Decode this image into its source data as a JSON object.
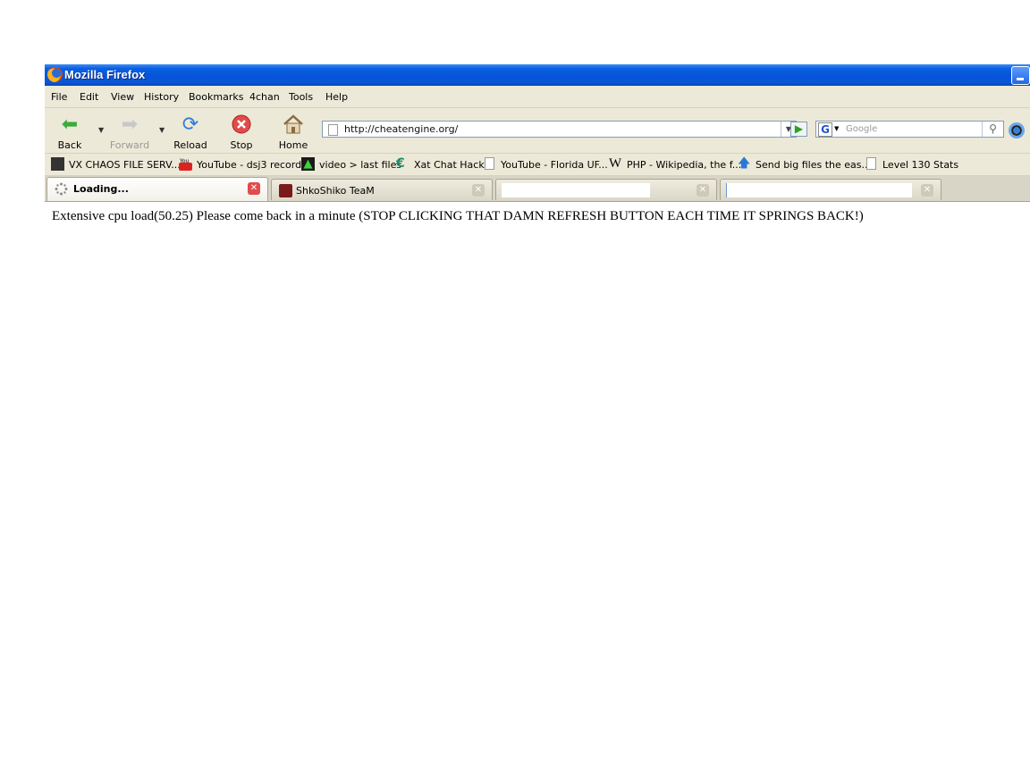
{
  "window": {
    "title": "Mozilla Firefox"
  },
  "menu": [
    "File",
    "Edit",
    "View",
    "History",
    "Bookmarks",
    "4chan",
    "Tools",
    "Help"
  ],
  "nav": {
    "back_label": "Back",
    "forward_label": "Forward",
    "reload_label": "Reload",
    "stop_label": "Stop",
    "home_label": "Home"
  },
  "address": {
    "url": "http://cheatengine.org/"
  },
  "search": {
    "placeholder": "Google",
    "engine_letter": "G"
  },
  "bookmarks": [
    "VX CHAOS FILE SERV...",
    "YouTube - dsj3 records",
    "video > last files",
    "Xat Chat Hack",
    "YouTube - Florida UF...",
    "PHP - Wikipedia, the f...",
    "Send big files the eas...",
    "Level 130 Stats"
  ],
  "tabs": [
    {
      "label": "Loading...",
      "active": true
    },
    {
      "label": "ShkoShiko TeaM",
      "active": false
    },
    {
      "label": "",
      "active": false
    },
    {
      "label": "",
      "active": false
    }
  ],
  "page": {
    "message": "Extensive cpu load(50.25) Please come back in a minute (STOP CLICKING THAT DAMN REFRESH BUTTON EACH TIME IT SPRINGS BACK!)"
  },
  "colors": {
    "titlebar": "#0553d8",
    "chrome": "#ece9d8",
    "back_arrow": "#3daa3d",
    "stop_red": "#e14b4b",
    "reload_blue": "#2f7fd8"
  }
}
